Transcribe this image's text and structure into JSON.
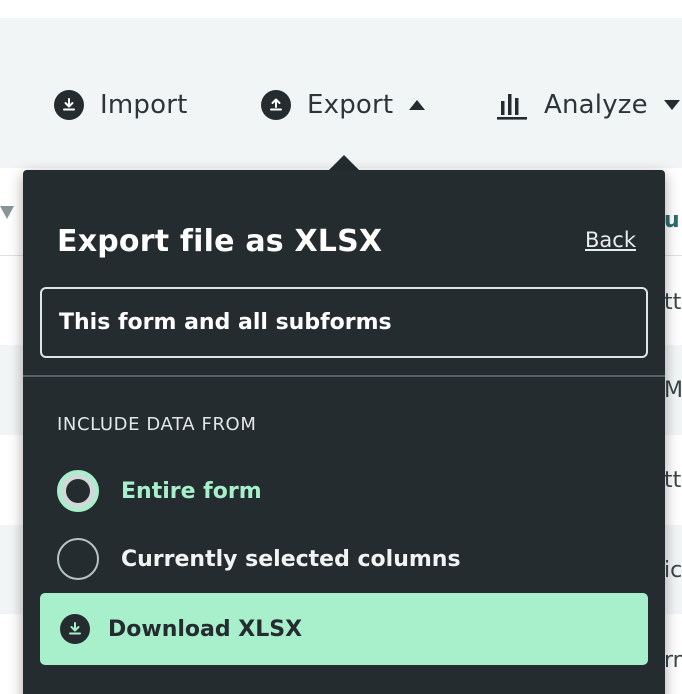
{
  "toolbar": {
    "import_label": "Import",
    "export_label": "Export",
    "analyze_label": "Analyze"
  },
  "background_table": {
    "header_edge_text": "u",
    "row_edge_texts": [
      "tt",
      "Mo",
      "tt",
      "ic",
      "rn"
    ]
  },
  "export_panel": {
    "title": "Export file as XLSX",
    "back_label": "Back",
    "scope_select_value": "This form and all subforms",
    "section_label": "INCLUDE DATA FROM",
    "options": [
      {
        "label": "Entire form",
        "selected": true
      },
      {
        "label": "Currently selected columns",
        "selected": false
      }
    ],
    "download_label": "Download XLSX"
  },
  "colors": {
    "panel_background": "#242c2f",
    "accent_mint": "#a8efcb",
    "toolbar_background": "#f2f5f6"
  }
}
